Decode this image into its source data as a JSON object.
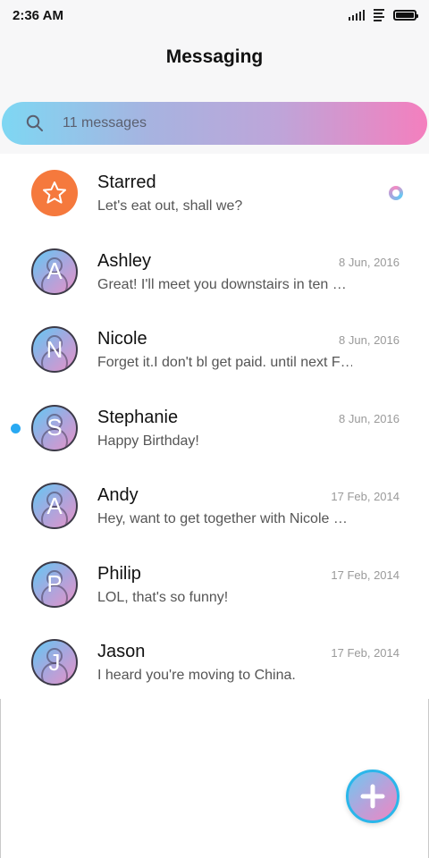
{
  "status_bar": {
    "time": "2:36 AM"
  },
  "header": {
    "title": "Messaging"
  },
  "search": {
    "placeholder": "11 messages"
  },
  "conversations": [
    {
      "name": "Starred",
      "preview": "Let's eat out, shall we?",
      "date": "",
      "avatar_letter": "",
      "avatar_icon": "star-icon"
    },
    {
      "name": "Ashley",
      "preview": "Great! I'll meet you downstairs in ten …",
      "date": "8 Jun, 2016",
      "avatar_letter": "A"
    },
    {
      "name": "Nicole",
      "preview": "Forget it.I don't bl get paid. until next F…",
      "date": "8 Jun, 2016",
      "avatar_letter": "N"
    },
    {
      "name": "Stephanie",
      "preview": "Happy Birthday!",
      "date": "8 Jun, 2016",
      "avatar_letter": "S",
      "unread": true
    },
    {
      "name": "Andy",
      "preview": "Hey, want to get together with Nicole …",
      "date": "17 Feb, 2014",
      "avatar_letter": "A"
    },
    {
      "name": "Philip",
      "preview": "LOL, that's so funny!",
      "date": "17 Feb, 2014",
      "avatar_letter": "P"
    },
    {
      "name": "Jason",
      "preview": "I heard you're moving to China.",
      "date": "17 Feb, 2014",
      "avatar_letter": "J"
    }
  ],
  "fab": {
    "icon": "plus-icon"
  },
  "colors": {
    "accent_blue": "#29a9f2",
    "starred_orange": "#f5793d",
    "gradient_start": "#7ed7f3",
    "gradient_end": "#f47fbe"
  }
}
